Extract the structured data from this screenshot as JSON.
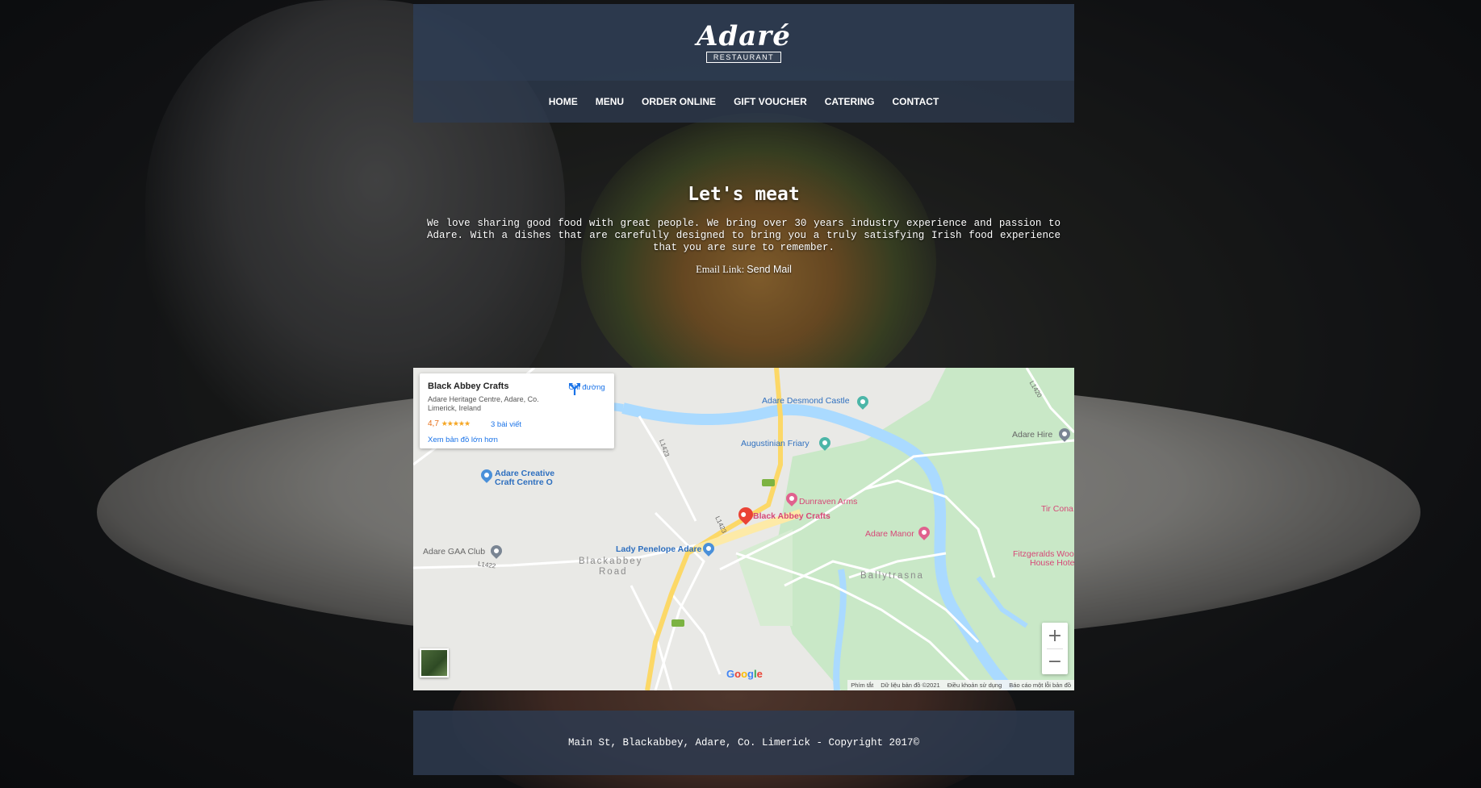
{
  "brand": {
    "name": "Adaré",
    "tagline": "RESTAURANT"
  },
  "nav": {
    "items": [
      {
        "label": "HOME"
      },
      {
        "label": "MENU"
      },
      {
        "label": "ORDER ONLINE"
      },
      {
        "label": "GIFT VOUCHER"
      },
      {
        "label": "CATERING"
      },
      {
        "label": "CONTACT"
      }
    ]
  },
  "hero": {
    "title": "Let's meat",
    "text": "We love sharing good food with great people. We bring over 30 years industry experience and passion to Adare. With a dishes that are carefully designed to bring you a truly satisfying Irish food experience that you are sure to remember.",
    "email_prefix": "Email Link: ",
    "email_link": "Send Mail"
  },
  "map": {
    "card": {
      "place": "Black Abbey Crafts",
      "address": "Adare Heritage Centre, Adare, Co. Limerick, Ireland",
      "rating": "4,7",
      "stars": "★★★★★",
      "reviews": "3 bài viết",
      "view_larger": "Xem bản đồ lớn hơn",
      "directions": "Chỉ đường"
    },
    "labels": {
      "desmond_castle": "Adare Desmond Castle",
      "augustinian_friary": "Augustinian Friary",
      "adare_hire": "Adare Hire",
      "creative_craft": "Adare Creative",
      "creative_craft_2": "Craft Centre O",
      "dunraven": "Dunraven Arms",
      "black_abbey": "Black Abbey Crafts",
      "tir_cona": "Tir Cona",
      "adare_manor": "Adare Manor",
      "fitzgeralds": "Fitzgeralds Woo",
      "fitzgeralds_2": "House Hotel",
      "gaa_club": "Adare GAA Club",
      "lady_penelope": "Lady Penelope Adare",
      "blackabbey_road": "Blackabbey",
      "blackabbey_road_2": "Road",
      "ballytrasna": "Ballytrasna",
      "road_l1420": "L1420",
      "road_l1422": "L1422",
      "road_l1423": "L1423",
      "road_n21": "N21",
      "road_l1423b": "L1423"
    },
    "zoom_in": "+",
    "zoom_out": "−",
    "google": "Google",
    "attribution": {
      "shortcuts": "Phím tắt",
      "map_data": "Dữ liệu bản đồ ©2021",
      "terms": "Điều khoản sử dụng",
      "report": "Báo cáo một lỗi bản đồ"
    },
    "colors": {
      "water": "#aadaff",
      "park": "#c9e8c7",
      "highway": "#fcd867",
      "pin": "#ea4335"
    }
  },
  "footer": {
    "text": "Main St, Blackabbey, Adare, Co. Limerick - Copyright 2017©"
  }
}
